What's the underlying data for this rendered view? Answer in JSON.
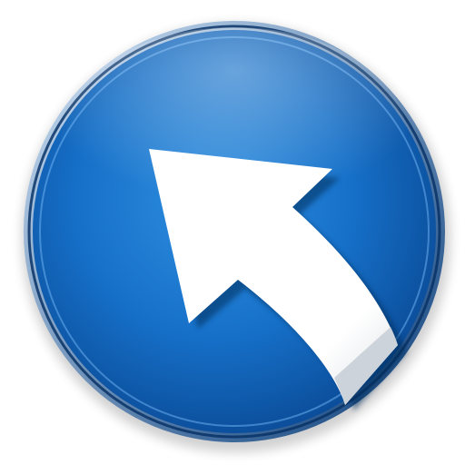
{
  "icon": {
    "name": "arrow-up-left-icon",
    "shape": "circular-button",
    "colors": {
      "background": "#ffffff",
      "rim_light": "#cfe3f7",
      "rim_dark": "#0b3e7a",
      "face_center": "#2f8fe0",
      "face_mid": "#1670c8",
      "face_edge": "#0a4a96",
      "arrow_fill": "#ffffff",
      "arrow_shade": "#d9dde3",
      "arrow_shadow": "#062d5c"
    }
  }
}
